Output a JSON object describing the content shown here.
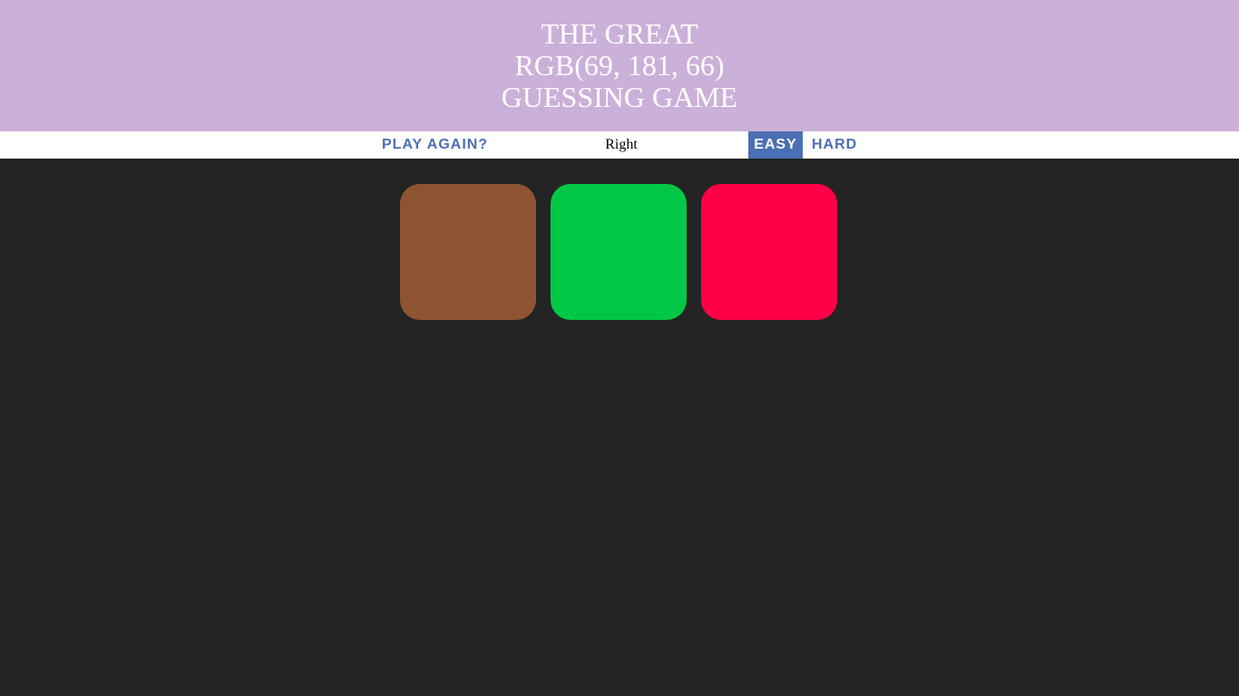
{
  "header": {
    "line1": "THE GREAT",
    "color_display": "RGB(69, 181, 66)",
    "line3": "GUESSING GAME",
    "background": "#cbb0d9"
  },
  "controls": {
    "reset_label": "Play Again?",
    "message": "Right",
    "easy_label": "Easy",
    "hard_label": "Hard",
    "selected_mode": "Easy",
    "accent_color": "#4b6fb3"
  },
  "squares": [
    {
      "color": "#8e5431"
    },
    {
      "color": "#00c846"
    },
    {
      "color": "#ff0048"
    }
  ],
  "background_color": "#232323"
}
